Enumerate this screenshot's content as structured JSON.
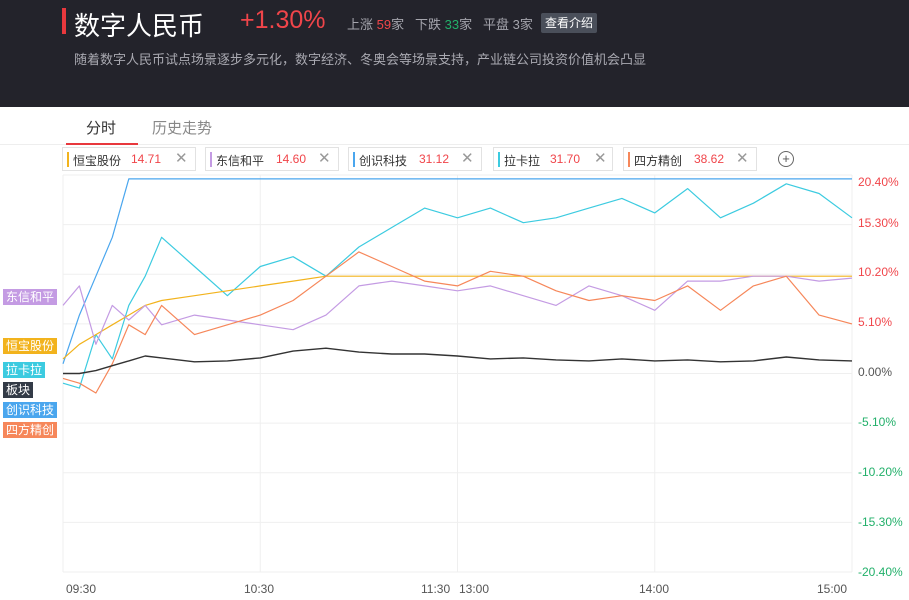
{
  "header": {
    "title": "数字人民币",
    "change": "+1.30%",
    "up_label": "上涨",
    "up_count": "59",
    "up_unit": "家",
    "down_label": "下跌",
    "down_count": "33",
    "down_unit": "家",
    "flat_label": "平盘",
    "flat_count": "3",
    "flat_unit": "家",
    "intro_button": "查看介绍",
    "description": "随着数字人民币试点场景逐步多元化，数字经济、冬奥会等场景支持，产业链公司投资价值机会凸显"
  },
  "tabs": [
    {
      "label": "分时"
    },
    {
      "label": "历史走势"
    }
  ],
  "chips": [
    {
      "name": "恒宝股份",
      "price": "14.71",
      "color": "#f2b31d"
    },
    {
      "name": "东信和平",
      "price": "14.60",
      "color": "#c49be3"
    },
    {
      "name": "创识科技",
      "price": "31.12",
      "color": "#4aa6ee"
    },
    {
      "name": "拉卡拉",
      "price": "31.70",
      "color": "#3ccbe0"
    },
    {
      "name": "四方精创",
      "price": "38.62",
      "color": "#f6875a"
    }
  ],
  "colors": {
    "up": "#f0454a",
    "down": "#22b06a",
    "header_bg": "#23232b",
    "index_line": "#333333"
  },
  "icons": {
    "close": "close-icon",
    "add": "add-circle-icon"
  },
  "left_tags": [
    {
      "label": "东信和平",
      "color": "#c49be3"
    },
    {
      "label": "恒宝股份",
      "color": "#f2b31d"
    },
    {
      "label": "拉卡拉",
      "color": "#3ccbe0"
    },
    {
      "label": "板块",
      "color": "#333b47"
    },
    {
      "label": "创识科技",
      "color": "#4aa6ee"
    },
    {
      "label": "四方精创",
      "color": "#f6875a"
    }
  ],
  "chart_data": {
    "type": "line",
    "x_ticks": [
      "09:30",
      "10:30",
      "11:30",
      "13:00",
      "14:00",
      "15:00"
    ],
    "y_ticks": [
      "20.40%",
      "15.30%",
      "10.20%",
      "5.10%",
      "0.00%",
      "-5.10%",
      "-10.20%",
      "-15.30%",
      "-20.40%"
    ],
    "ylim": [
      -20.4,
      20.4
    ],
    "grid": true,
    "sessions": [
      [
        "09:30",
        "11:30"
      ],
      [
        "13:00",
        "15:00"
      ]
    ],
    "x_minutes": [
      0,
      5,
      10,
      15,
      20,
      25,
      30,
      40,
      50,
      60,
      70,
      80,
      90,
      100,
      110,
      120,
      130,
      140,
      150,
      160,
      170,
      180,
      190,
      200,
      210,
      220,
      230,
      240
    ],
    "series": [
      {
        "name": "创识科技",
        "color": "#4aa6ee",
        "values": [
          1.0,
          6.0,
          10.0,
          14.0,
          20.0,
          20.0,
          20.0,
          20.0,
          20.0,
          20.0,
          20.0,
          20.0,
          20.0,
          20.0,
          20.0,
          20.0,
          20.0,
          20.0,
          20.0,
          20.0,
          20.0,
          20.0,
          20.0,
          20.0,
          20.0,
          20.0,
          20.0,
          20.0
        ]
      },
      {
        "name": "拉卡拉",
        "color": "#3ccbe0",
        "values": [
          -1.0,
          -1.5,
          4.0,
          1.5,
          7.0,
          10.0,
          14.0,
          11.0,
          8.0,
          11.0,
          12.0,
          10.0,
          13.0,
          15.0,
          17.0,
          16.0,
          17.0,
          15.5,
          16.0,
          17.0,
          18.0,
          16.5,
          19.0,
          16.0,
          17.5,
          19.5,
          18.5,
          16.0
        ]
      },
      {
        "name": "恒宝股份",
        "color": "#f2b31d",
        "values": [
          1.5,
          3.0,
          4.0,
          5.0,
          6.0,
          7.0,
          7.5,
          8.0,
          8.5,
          9.0,
          9.5,
          10.0,
          10.0,
          10.0,
          10.0,
          10.0,
          10.0,
          10.0,
          10.0,
          10.0,
          10.0,
          10.0,
          10.0,
          10.0,
          10.0,
          10.0,
          10.0,
          10.0
        ]
      },
      {
        "name": "东信和平",
        "color": "#c49be3",
        "values": [
          7.0,
          9.0,
          3.0,
          7.0,
          5.5,
          7.0,
          5.0,
          6.0,
          5.5,
          5.0,
          4.5,
          6.0,
          9.0,
          9.5,
          9.0,
          8.5,
          9.0,
          8.0,
          7.0,
          9.0,
          8.0,
          6.5,
          9.5,
          9.5,
          10.0,
          10.0,
          9.5,
          9.8
        ]
      },
      {
        "name": "四方精创",
        "color": "#f6875a",
        "values": [
          -0.5,
          -1.0,
          -2.0,
          1.0,
          5.0,
          4.0,
          7.0,
          4.0,
          5.0,
          6.0,
          7.5,
          10.0,
          12.5,
          11.0,
          9.5,
          9.0,
          10.5,
          10.0,
          8.5,
          7.5,
          8.0,
          7.5,
          9.0,
          6.5,
          9.0,
          10.0,
          6.0,
          5.1
        ]
      },
      {
        "name": "板块",
        "color": "#333333",
        "values": [
          0.0,
          0.0,
          0.3,
          0.8,
          1.3,
          1.8,
          1.6,
          1.2,
          1.3,
          1.6,
          2.3,
          2.6,
          2.2,
          2.0,
          2.0,
          1.8,
          1.5,
          1.6,
          1.4,
          1.3,
          1.5,
          1.3,
          1.4,
          1.2,
          1.3,
          1.7,
          1.4,
          1.3
        ]
      }
    ]
  }
}
